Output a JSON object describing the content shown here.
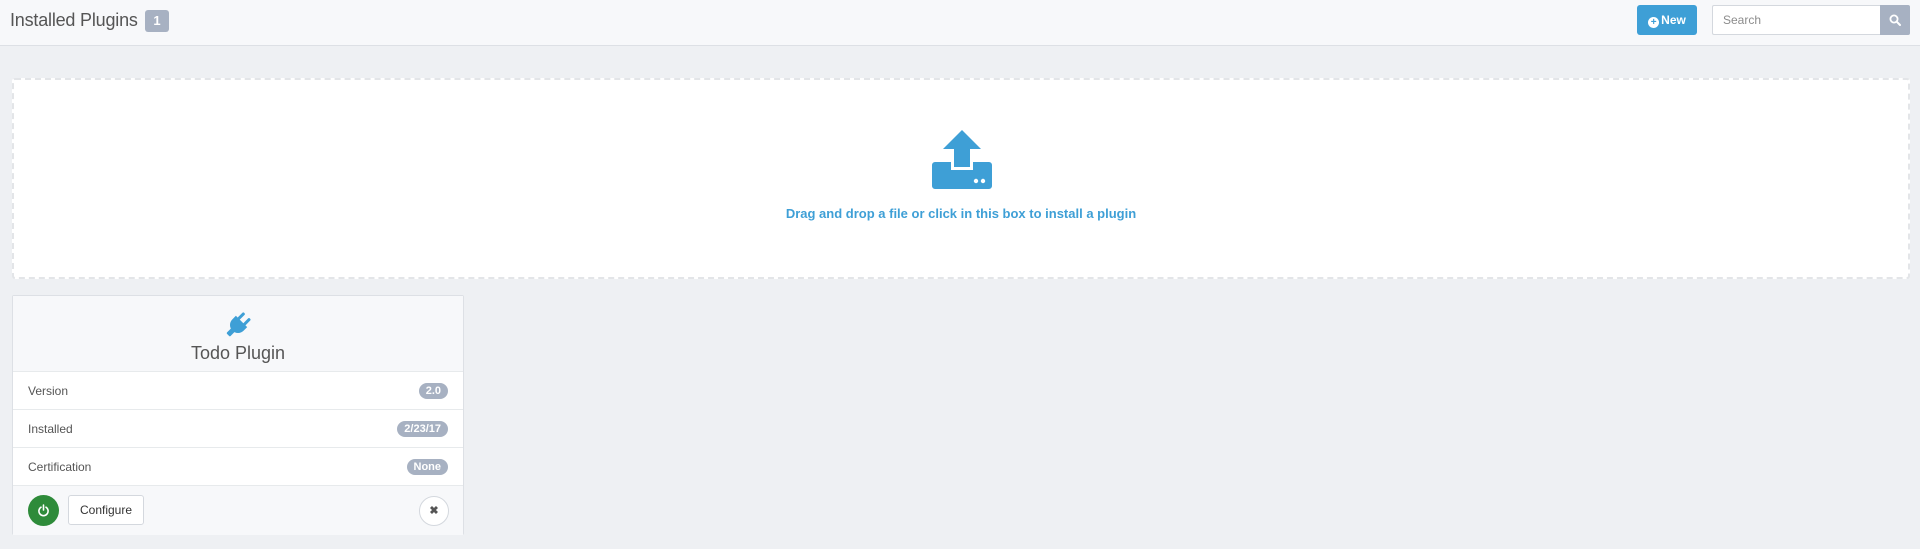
{
  "header": {
    "title": "Installed Plugins",
    "count": "1",
    "new_label": "New",
    "search_placeholder": "Search"
  },
  "dropzone": {
    "text": "Drag and drop a file or click in this box to install a plugin"
  },
  "plugin": {
    "name": "Todo Plugin",
    "rows": [
      {
        "label": "Version",
        "value": "2.0"
      },
      {
        "label": "Installed",
        "value": "2/23/17"
      },
      {
        "label": "Certification",
        "value": "None"
      }
    ],
    "configure_label": "Configure"
  },
  "icons": {
    "new": "plus-circle-icon",
    "search": "search-icon",
    "upload": "upload-icon",
    "plugin": "plug-icon",
    "power": "power-icon",
    "remove": "close-icon"
  },
  "colors": {
    "accent": "#3e9fd6",
    "badge": "#a7b1c2",
    "power": "#2e8b3a",
    "background": "#eef0f3"
  }
}
